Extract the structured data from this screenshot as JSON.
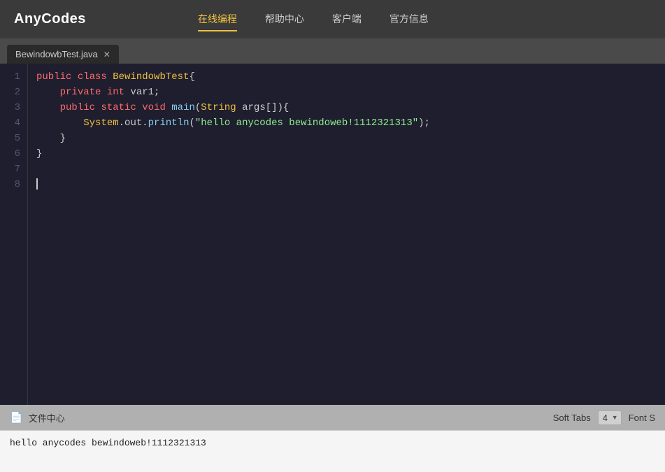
{
  "header": {
    "logo": "AnyCodes",
    "nav": [
      {
        "label": "在线编程",
        "active": true
      },
      {
        "label": "帮助中心",
        "active": false
      },
      {
        "label": "客户端",
        "active": false
      },
      {
        "label": "官方信息",
        "active": false
      }
    ]
  },
  "tabs": [
    {
      "label": "BewindowbTest.java",
      "active": true
    }
  ],
  "editor": {
    "lines": [
      {
        "num": 1,
        "html": "<span class='kw-public'>public</span> <span class='kw-class'>class</span> <span class='type-name'>BewindowbTest</span><span class='plain'>{</span>"
      },
      {
        "num": 2,
        "html": "    <span class='kw-private'>private</span> <span class='kw-int'>int</span> <span class='plain'>var1;</span>"
      },
      {
        "num": 3,
        "html": "    <span class='kw-public'>public</span> <span class='kw-static'>static</span> <span class='kw-void'>void</span> <span class='method-name'>main</span><span class='plain'>(</span><span class='type-name'>String</span> <span class='plain'>args[]){</span>"
      },
      {
        "num": 4,
        "html": "        <span class='type-name'>System</span><span class='plain'>.out.</span><span class='method-name'>println</span><span class='plain'>(</span><span class='string-lit'>\"hello anycodes bewindoweb!1112321313\"</span><span class='plain'>);</span>"
      },
      {
        "num": 5,
        "html": "    <span class='plain'>}</span>"
      },
      {
        "num": 6,
        "html": "<span class='plain'>}</span>"
      },
      {
        "num": 7,
        "html": ""
      },
      {
        "num": 8,
        "html": ""
      }
    ]
  },
  "status_bar": {
    "file_center_label": "文件中心",
    "soft_tabs_label": "Soft Tabs",
    "tabs_value": "4",
    "font_size_label": "Font S"
  },
  "output": {
    "text": "hello anycodes bewindoweb!1112321313"
  }
}
